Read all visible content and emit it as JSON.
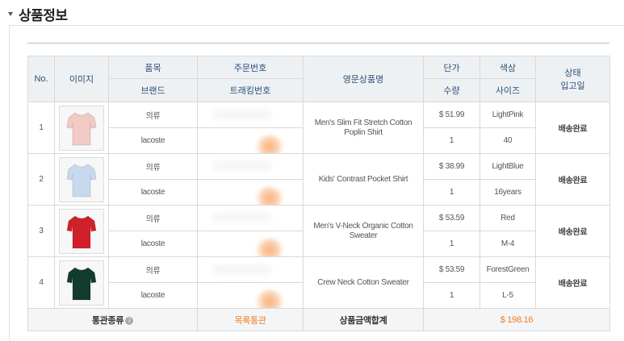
{
  "section": {
    "title": "상품정보"
  },
  "table": {
    "headers": {
      "no": "No.",
      "image": "이미지",
      "category": "품목",
      "brand": "브랜드",
      "order_no": "주문번호",
      "tracking_no": "트래킹번호",
      "product_name": "영문상품명",
      "unit_price": "단가",
      "quantity": "수량",
      "color": "색상",
      "size": "사이즈",
      "status": "상태",
      "received_date": "입고일"
    },
    "rows": [
      {
        "no": "1",
        "category": "의류",
        "brand": "lacoste",
        "product_name": "Men's Slim Fit Stretch Cotton Poplin Shirt",
        "unit_price": "$ 51.99",
        "quantity": "1",
        "color": "LightPink",
        "size": "40",
        "status": "배송완료",
        "image_icon": "pink-shirt-icon",
        "image_color": "#f2c9c3"
      },
      {
        "no": "2",
        "category": "의류",
        "brand": "lacoste",
        "product_name": "Kids' Contrast Pocket Shirt",
        "unit_price": "$ 38.99",
        "quantity": "1",
        "color": "LightBlue",
        "size": "16years",
        "status": "배송완료",
        "image_icon": "blue-shirt-icon",
        "image_color": "#c7d9ec"
      },
      {
        "no": "3",
        "category": "의류",
        "brand": "lacoste",
        "product_name": "Men's V-Neck Organic Cotton Sweater",
        "unit_price": "$ 53.59",
        "quantity": "1",
        "color": "Red",
        "size": "M-4",
        "status": "배송완료",
        "image_icon": "red-sweater-icon",
        "image_color": "#d0202a"
      },
      {
        "no": "4",
        "category": "의류",
        "brand": "lacoste",
        "product_name": "Crew Neck Cotton Sweater",
        "unit_price": "$ 53.59",
        "quantity": "1",
        "color": "ForestGreen",
        "size": "L-5",
        "status": "배송완료",
        "image_icon": "green-sweater-icon",
        "image_color": "#123b2c"
      }
    ],
    "footer": {
      "customs_label": "통관종류",
      "customs_value": "목록통관",
      "total_label": "상품금액합계",
      "total_value": "$ 198.16"
    }
  }
}
